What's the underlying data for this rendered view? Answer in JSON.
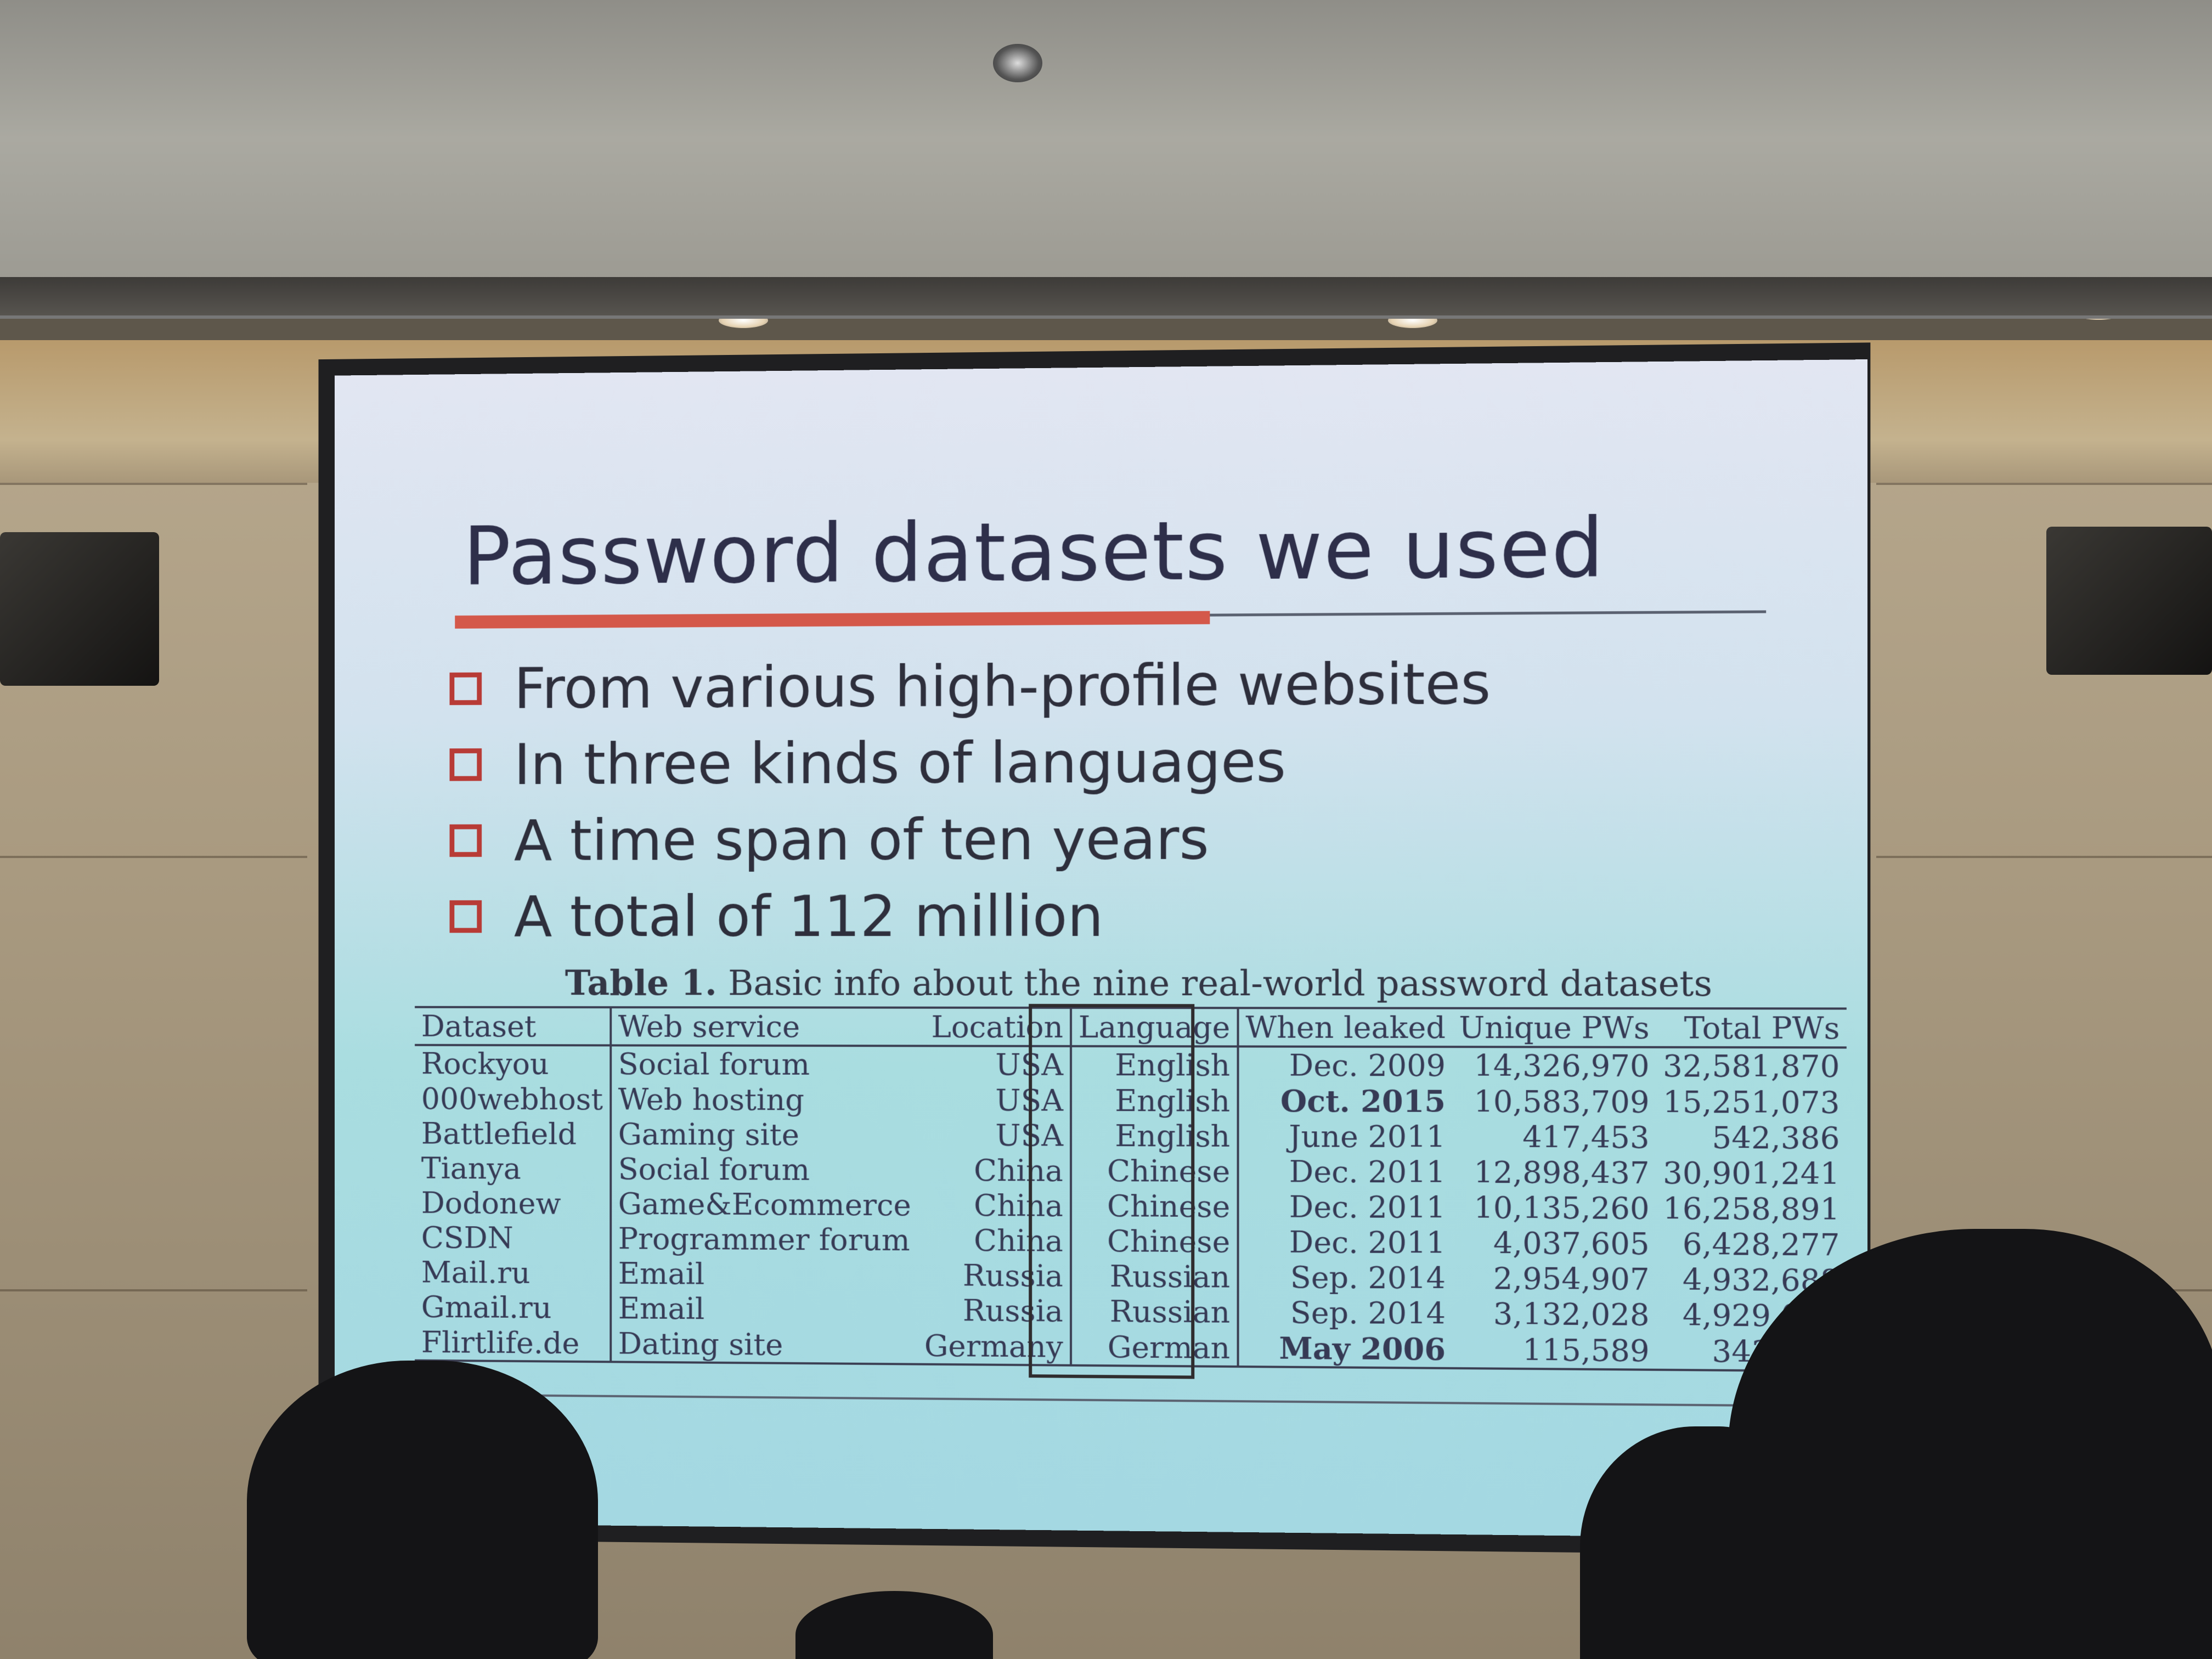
{
  "slide": {
    "title": "Password datasets we used",
    "bullets": [
      "From various high-profile websites",
      "In three kinds of languages",
      "A time span of ten years",
      "A total of 112 million"
    ],
    "table": {
      "caption_label": "Table 1.",
      "caption_text": "Basic info about the nine real-world password datasets",
      "columns": [
        "Dataset",
        "Web service",
        "Location",
        "Language",
        "When leaked",
        "Unique PWs",
        "Total PWs"
      ],
      "rows": [
        [
          "Rockyou",
          "Social forum",
          "USA",
          "English",
          "Dec. 2009",
          "14,326,970",
          "32,581,870"
        ],
        [
          "000webhost",
          "Web hosting",
          "USA",
          "English",
          "Oct. 2015",
          "10,583,709",
          "15,251,073"
        ],
        [
          "Battlefield",
          "Gaming site",
          "USA",
          "English",
          "June 2011",
          "417,453",
          "542,386"
        ],
        [
          "Tianya",
          "Social forum",
          "China",
          "Chinese",
          "Dec. 2011",
          "12,898,437",
          "30,901,241"
        ],
        [
          "Dodonew",
          "Game&Ecommerce",
          "China",
          "Chinese",
          "Dec. 2011",
          "10,135,260",
          "16,258,891"
        ],
        [
          "CSDN",
          "Programmer forum",
          "China",
          "Chinese",
          "Dec. 2011",
          "4,037,605",
          "6,428,277"
        ],
        [
          "Mail.ru",
          "Email",
          "Russia",
          "Russian",
          "Sep. 2014",
          "2,954,907",
          "4,932,688"
        ],
        [
          "Gmail.ru",
          "Email",
          "Russia",
          "Russian",
          "Sep. 2014",
          "3,132,028",
          "4,929,090"
        ],
        [
          "Flirtlife.de",
          "Dating site",
          "Germany",
          "German",
          "May 2006",
          "115,589",
          "343,064"
        ]
      ]
    }
  },
  "colors": {
    "title_text": "#2e2f4a",
    "accent_red": "#d4584a",
    "checkbox": "#b83b36",
    "screen_top": "#e2e6f2",
    "screen_bottom": "#a4d8e2"
  }
}
